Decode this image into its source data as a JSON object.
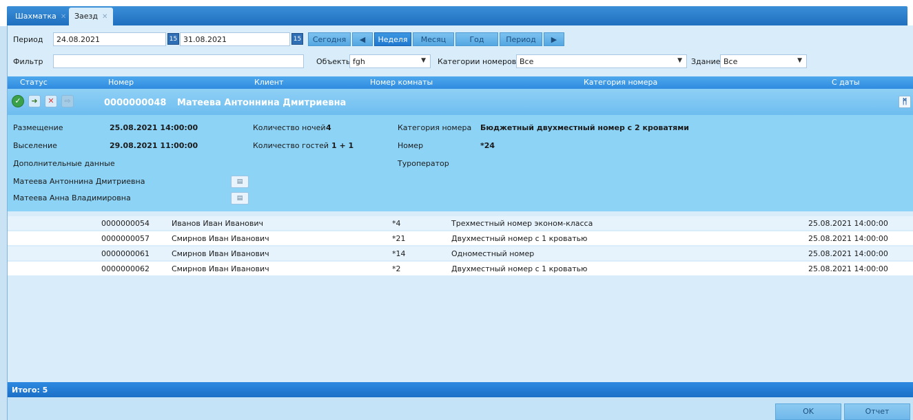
{
  "tabs": [
    {
      "label": "Шахматка"
    },
    {
      "label": "Заезд"
    }
  ],
  "filters": {
    "period_label": "Период",
    "date_from": "24.08.2021",
    "date_to": "31.08.2021",
    "calendar_day": "15",
    "filter_label": "Фильтр",
    "filter_value": "",
    "objects_label": "Объекты",
    "objects_value": "fgh",
    "categories_label": "Категории номеров",
    "categories_value": "Все",
    "building_label": "Здание",
    "building_value": "Все"
  },
  "nav": {
    "today": "Сегодня",
    "week": "Неделя",
    "month": "Месяц",
    "year": "Год",
    "period": "Период"
  },
  "columns": {
    "status": "Статус",
    "number": "Номер",
    "client": "Клиент",
    "room": "Номер комнаты",
    "category": "Категория номера",
    "from_date": "С даты"
  },
  "booking": {
    "number": "0000000048",
    "client": "Матеева Антоннина Дмитриевна",
    "labels": {
      "placement": "Размещение",
      "checkout": "Выселение",
      "extra": "Дополнительные данные",
      "nights": "Количество ночей",
      "guests": "Количество гостей",
      "category": "Категория номера",
      "room": "Номер",
      "tour_operator": "Туроператор"
    },
    "placement": "25.08.2021 14:00:00",
    "checkout": "29.08.2021 11:00:00",
    "nights": "4",
    "guests": "1 + 1",
    "category": "Бюджетный двухместный номер с 2 кроватями",
    "room": "*24",
    "guest_names": [
      "Матеева Антоннина Дмитриевна",
      "Матеева Анна Владимировна"
    ]
  },
  "rows": [
    {
      "number": "0000000054",
      "client": "Иванов Иван Иванович",
      "room": "*4",
      "category": "Трехместный номер эконом-класса",
      "from_date": "25.08.2021 14:00:00"
    },
    {
      "number": "0000000057",
      "client": "Смирнов Иван Иванович",
      "room": "*21",
      "category": "Двухместный номер с 1 кроватью",
      "from_date": "25.08.2021 14:00:00"
    },
    {
      "number": "0000000061",
      "client": "Смирнов Иван Иванович",
      "room": "*14",
      "category": "Одноместный номер",
      "from_date": "25.08.2021 14:00:00"
    },
    {
      "number": "0000000062",
      "client": "Смирнов Иван Иванович",
      "room": "*2",
      "category": "Двухместный номер с 1 кроватью",
      "from_date": "25.08.2021 14:00:00"
    }
  ],
  "footer": {
    "total": "Итого: 5"
  },
  "buttons": {
    "ok": "OK",
    "report": "Отчет"
  }
}
